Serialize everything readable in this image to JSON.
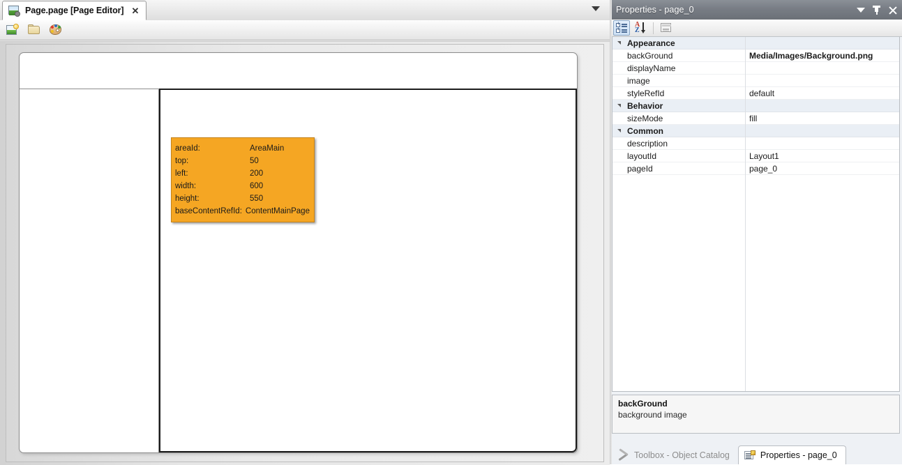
{
  "editor": {
    "tab": {
      "title": "Page.page [Page Editor]",
      "close_label": "✕",
      "icon": "page-editor-icon"
    },
    "tab_dropdown_icon": "chevron-down-icon",
    "toolbar": {
      "buttons": [
        {
          "name": "new-image-button",
          "icon": "image-icon",
          "tooltip": "Image"
        },
        {
          "name": "open-folder-button",
          "icon": "folder-icon",
          "tooltip": "Open"
        },
        {
          "name": "palette-button",
          "icon": "palette-icon",
          "tooltip": "Palette"
        }
      ]
    },
    "canvas": {
      "areas": [
        {
          "name": "area-header",
          "selected": false
        },
        {
          "name": "area-side",
          "selected": false
        },
        {
          "name": "area-main",
          "selected": true
        }
      ],
      "tooltip": {
        "rows": [
          {
            "key": "areaId:",
            "value": "AreaMain"
          },
          {
            "key": "top:",
            "value": "50"
          },
          {
            "key": "left:",
            "value": "200"
          },
          {
            "key": "width:",
            "value": "600"
          },
          {
            "key": "height:",
            "value": "550"
          }
        ],
        "last_row": {
          "key": "baseContentRefId:",
          "value": "ContentMainPage"
        },
        "background_color": "#f5a623"
      }
    }
  },
  "properties": {
    "title": "Properties - page_0",
    "title_buttons": [
      {
        "name": "window-menu-caret",
        "icon": "chevron-down-icon"
      },
      {
        "name": "pin-button",
        "icon": "pin-icon"
      },
      {
        "name": "close-button",
        "icon": "close-icon"
      }
    ],
    "toolbar": [
      {
        "name": "categorized-button",
        "icon": "categorized-icon",
        "pressed": true
      },
      {
        "name": "alphabetical-sort-button",
        "icon": "sort-az-icon",
        "pressed": false
      },
      {
        "name": "property-pages-button",
        "icon": "property-pages-icon",
        "pressed": false,
        "disabled": true
      }
    ],
    "groups": [
      {
        "name": "Appearance",
        "rows": [
          {
            "name": "backGround",
            "value": "Media/Images/Background.png",
            "bold": true
          },
          {
            "name": "displayName",
            "value": ""
          },
          {
            "name": "image",
            "value": ""
          },
          {
            "name": "styleRefId",
            "value": "default"
          }
        ]
      },
      {
        "name": "Behavior",
        "rows": [
          {
            "name": "sizeMode",
            "value": "fill"
          }
        ]
      },
      {
        "name": "Common",
        "rows": [
          {
            "name": "description",
            "value": ""
          },
          {
            "name": "layoutId",
            "value": "Layout1"
          },
          {
            "name": "pageId",
            "value": "page_0"
          }
        ]
      }
    ],
    "description_panel": {
      "title": "backGround",
      "text": "background image"
    },
    "bottom_tabs": [
      {
        "label": "Toolbox - Object Catalog",
        "icon": "toolbox-icon",
        "active": false
      },
      {
        "label": "Properties - page_0",
        "icon": "properties-icon",
        "active": true
      }
    ]
  },
  "colors": {
    "accent_orange": "#f5a623",
    "title_bar": "#787d85",
    "category_row": "#eaeff5",
    "selection_border": "#1c1c1c"
  }
}
